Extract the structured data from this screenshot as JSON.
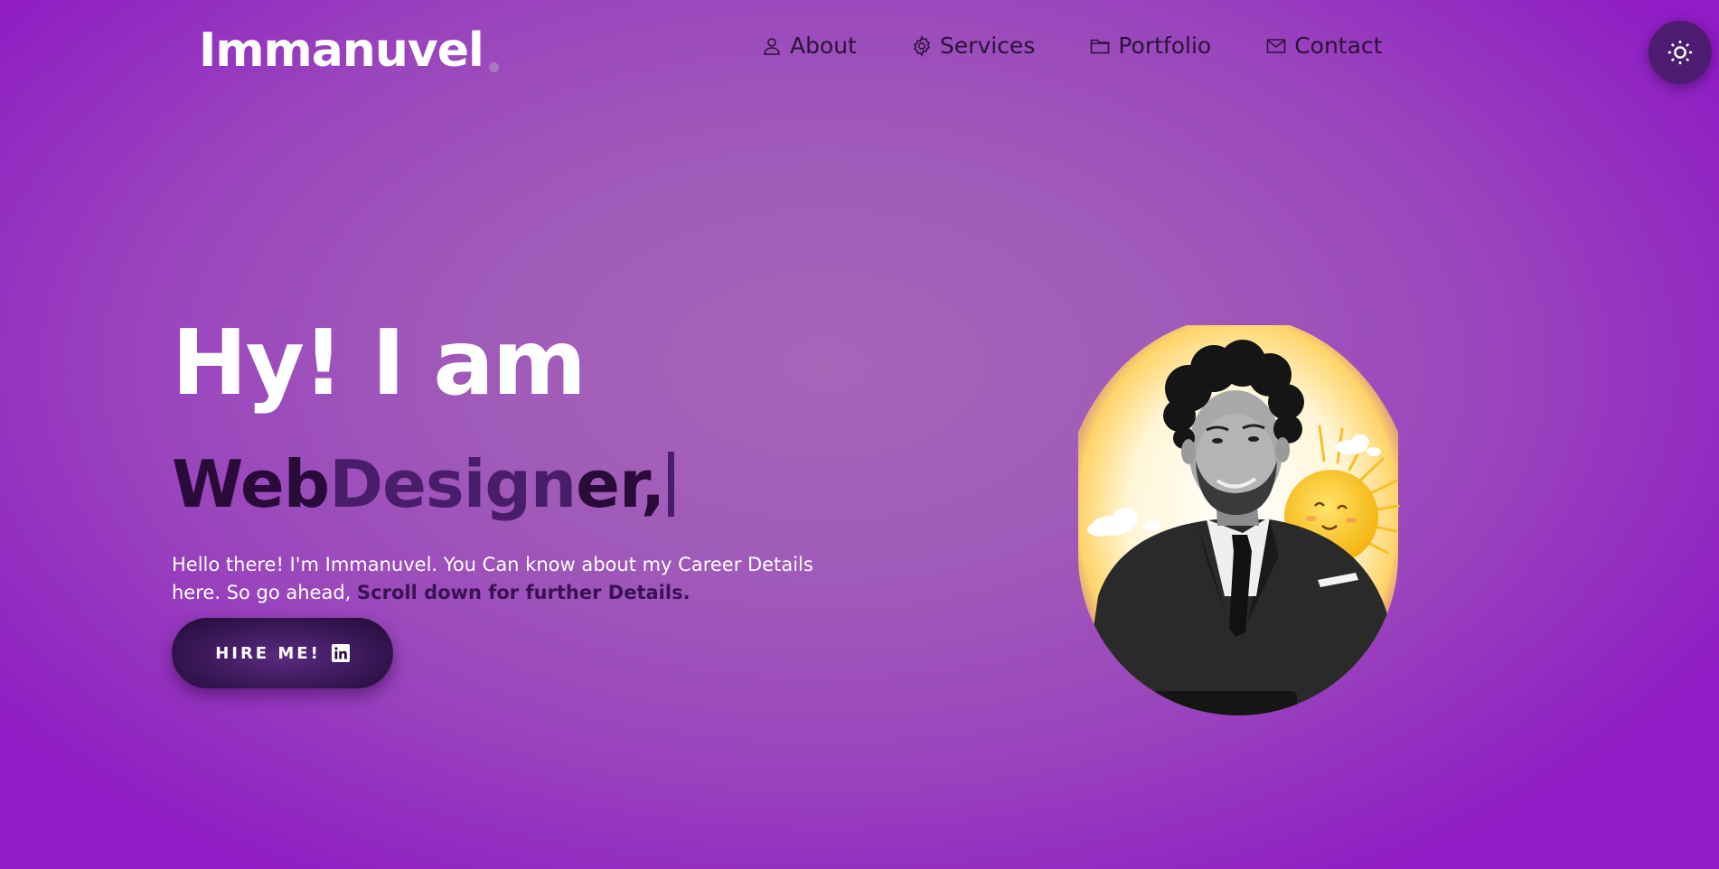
{
  "header": {
    "logo": "Immanuvel",
    "nav": [
      {
        "label": "About",
        "icon": "user-icon"
      },
      {
        "label": "Services",
        "icon": "gear-icon"
      },
      {
        "label": "Portfolio",
        "icon": "folder-icon"
      },
      {
        "label": "Contact",
        "icon": "envelope-icon"
      }
    ],
    "theme_toggle_icon": "sun-icon"
  },
  "hero": {
    "greeting": "Hy! I am",
    "role_part_1": "Web ",
    "role_part_2": "Design",
    "role_part_3": "er,",
    "intro": "Hello there! I'm Immanuvel. You Can know about my Career Details here. So go ahead, ",
    "intro_highlight": "Scroll down for further Details.",
    "hire_button_label": "HIRE ME!",
    "hire_button_icon": "linkedin-icon"
  },
  "colors": {
    "background": "#9a45bd",
    "accent_dark": "#2a0a38",
    "accent": "#4a1d6a",
    "nav_text": "#2b1239",
    "sun": "#f7c21c"
  }
}
